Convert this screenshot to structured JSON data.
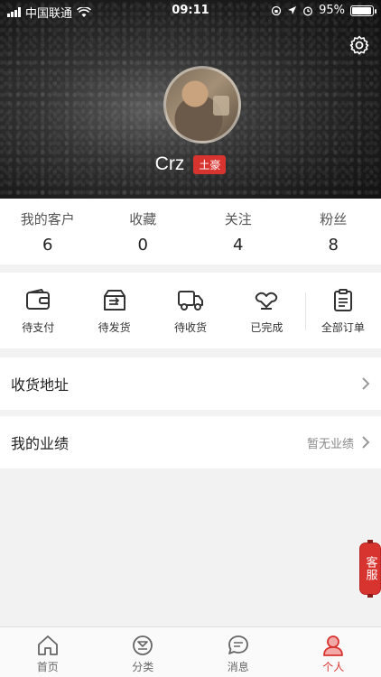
{
  "status_bar": {
    "carrier": "中国联通",
    "time": "09:11",
    "battery": "95%",
    "battery_level": 0.95
  },
  "profile": {
    "username": "Crz",
    "badge": "土豪"
  },
  "stats": [
    {
      "label": "我的客户",
      "value": "6"
    },
    {
      "label": "收藏",
      "value": "0"
    },
    {
      "label": "关注",
      "value": "4"
    },
    {
      "label": "粉丝",
      "value": "8"
    }
  ],
  "orders": [
    {
      "label": "待支付",
      "icon": "wallet-icon"
    },
    {
      "label": "待发货",
      "icon": "box-icon"
    },
    {
      "label": "待收货",
      "icon": "truck-icon"
    },
    {
      "label": "已完成",
      "icon": "handshake-icon"
    },
    {
      "label": "全部订单",
      "icon": "clipboard-icon"
    }
  ],
  "address": {
    "title": "收货地址"
  },
  "performance": {
    "title": "我的业绩",
    "value": "暂无业绩"
  },
  "service_button": {
    "label": "客服"
  },
  "tabbar": [
    {
      "label": "首页",
      "icon": "home-icon"
    },
    {
      "label": "分类",
      "icon": "category-icon"
    },
    {
      "label": "消息",
      "icon": "message-icon"
    },
    {
      "label": "个人",
      "icon": "user-icon",
      "active": true
    }
  ],
  "colors": {
    "accent": "#d7332f",
    "background": "#f2f2f2"
  }
}
